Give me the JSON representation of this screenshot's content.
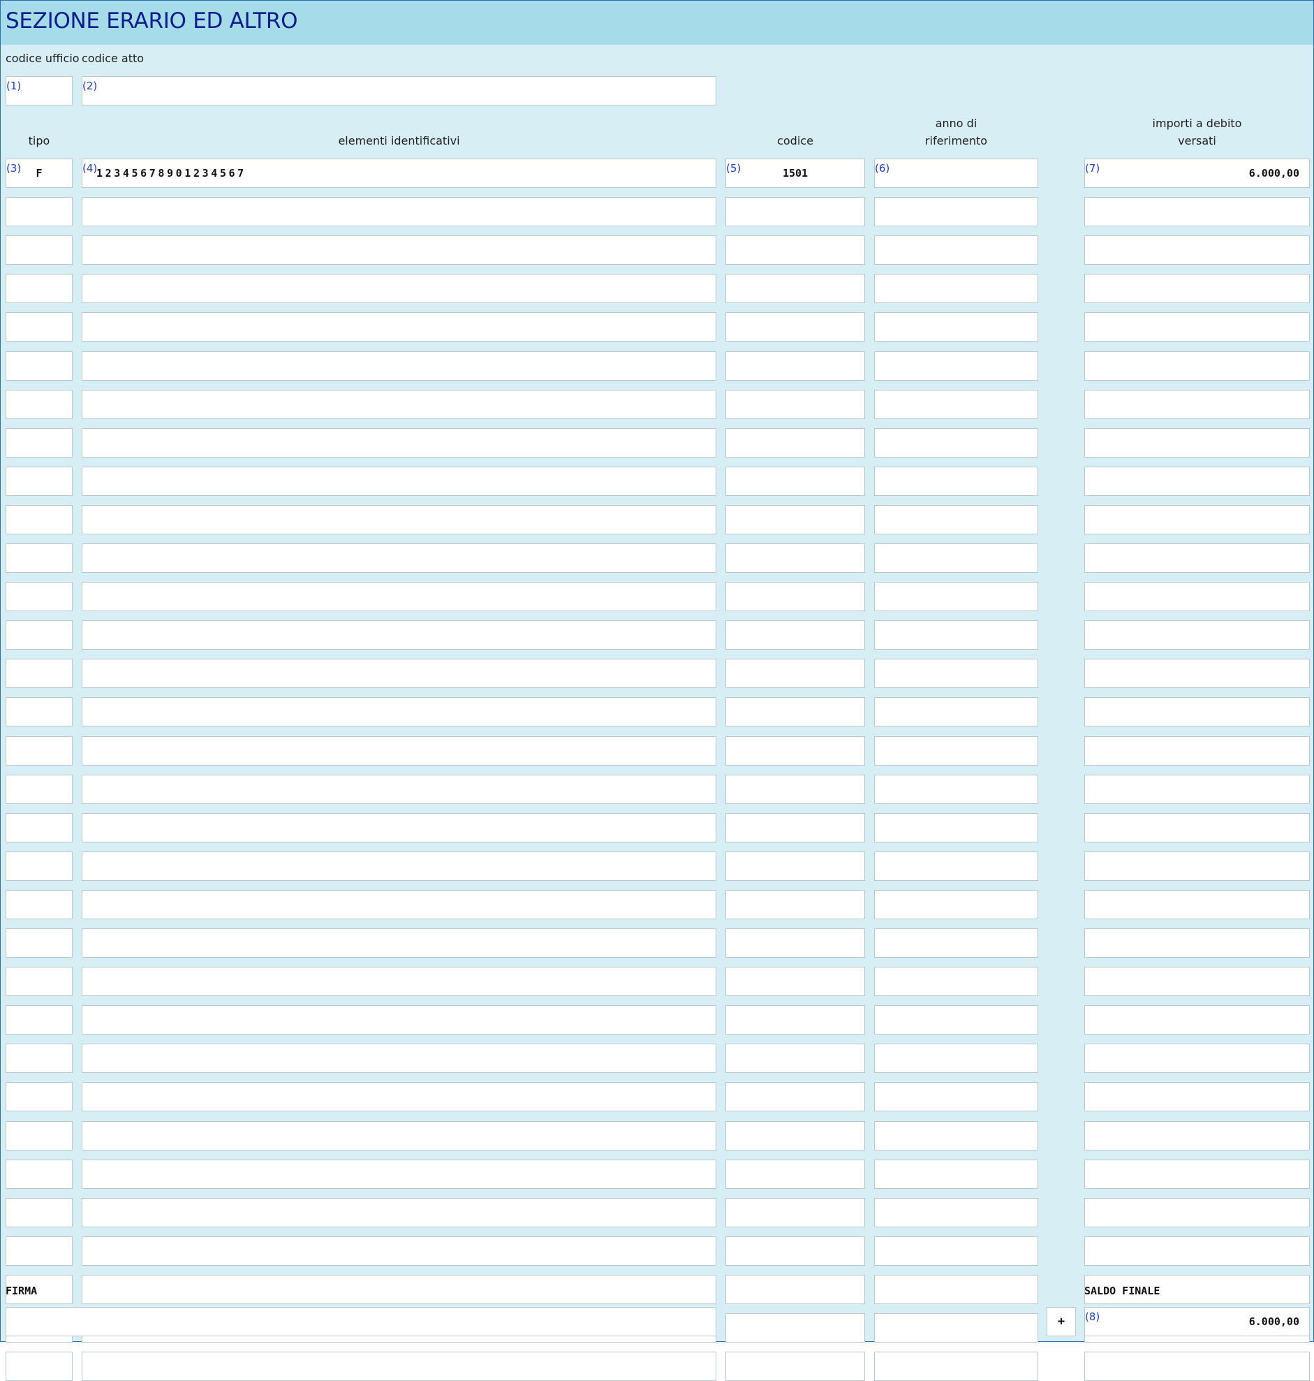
{
  "title": "SEZIONE ERARIO ED ALTRO",
  "labels": {
    "codice_ufficio": "codice ufficio",
    "codice_atto": "codice atto",
    "tipo": "tipo",
    "elementi_identificativi": "elementi identificativi",
    "codice": "codice",
    "anno_line1": "anno di",
    "anno_line2": "riferimento",
    "importi_line1": "importi a debito",
    "importi_line2": "versati",
    "firma": "FIRMA",
    "saldo_finale": "SALDO FINALE"
  },
  "field_numbers": {
    "codice_ufficio": "(1)",
    "codice_atto": "(2)",
    "tipo": "(3)",
    "elementi": "(4)",
    "codice": "(5)",
    "anno": "(6)",
    "importi": "(7)",
    "saldo": "(8)"
  },
  "top_fields": {
    "codice_ufficio": "",
    "codice_atto": ""
  },
  "rows": [
    {
      "tipo": "F",
      "elementi": "12345678901234567",
      "codice": "1501",
      "anno": "",
      "importo": "6.000,00"
    },
    {
      "tipo": "",
      "elementi": "",
      "codice": "",
      "anno": "",
      "importo": ""
    },
    {
      "tipo": "",
      "elementi": "",
      "codice": "",
      "anno": "",
      "importo": ""
    },
    {
      "tipo": "",
      "elementi": "",
      "codice": "",
      "anno": "",
      "importo": ""
    },
    {
      "tipo": "",
      "elementi": "",
      "codice": "",
      "anno": "",
      "importo": ""
    },
    {
      "tipo": "",
      "elementi": "",
      "codice": "",
      "anno": "",
      "importo": ""
    },
    {
      "tipo": "",
      "elementi": "",
      "codice": "",
      "anno": "",
      "importo": ""
    },
    {
      "tipo": "",
      "elementi": "",
      "codice": "",
      "anno": "",
      "importo": ""
    },
    {
      "tipo": "",
      "elementi": "",
      "codice": "",
      "anno": "",
      "importo": ""
    },
    {
      "tipo": "",
      "elementi": "",
      "codice": "",
      "anno": "",
      "importo": ""
    },
    {
      "tipo": "",
      "elementi": "",
      "codice": "",
      "anno": "",
      "importo": ""
    },
    {
      "tipo": "",
      "elementi": "",
      "codice": "",
      "anno": "",
      "importo": ""
    },
    {
      "tipo": "",
      "elementi": "",
      "codice": "",
      "anno": "",
      "importo": ""
    },
    {
      "tipo": "",
      "elementi": "",
      "codice": "",
      "anno": "",
      "importo": ""
    },
    {
      "tipo": "",
      "elementi": "",
      "codice": "",
      "anno": "",
      "importo": ""
    },
    {
      "tipo": "",
      "elementi": "",
      "codice": "",
      "anno": "",
      "importo": ""
    },
    {
      "tipo": "",
      "elementi": "",
      "codice": "",
      "anno": "",
      "importo": ""
    },
    {
      "tipo": "",
      "elementi": "",
      "codice": "",
      "anno": "",
      "importo": ""
    },
    {
      "tipo": "",
      "elementi": "",
      "codice": "",
      "anno": "",
      "importo": ""
    },
    {
      "tipo": "",
      "elementi": "",
      "codice": "",
      "anno": "",
      "importo": ""
    },
    {
      "tipo": "",
      "elementi": "",
      "codice": "",
      "anno": "",
      "importo": ""
    },
    {
      "tipo": "",
      "elementi": "",
      "codice": "",
      "anno": "",
      "importo": ""
    },
    {
      "tipo": "",
      "elementi": "",
      "codice": "",
      "anno": "",
      "importo": ""
    },
    {
      "tipo": "",
      "elementi": "",
      "codice": "",
      "anno": "",
      "importo": ""
    },
    {
      "tipo": "",
      "elementi": "",
      "codice": "",
      "anno": "",
      "importo": ""
    },
    {
      "tipo": "",
      "elementi": "",
      "codice": "",
      "anno": "",
      "importo": ""
    },
    {
      "tipo": "",
      "elementi": "",
      "codice": "",
      "anno": "",
      "importo": ""
    },
    {
      "tipo": "",
      "elementi": "",
      "codice": "",
      "anno": "",
      "importo": ""
    },
    {
      "tipo": "",
      "elementi": "",
      "codice": "",
      "anno": "",
      "importo": ""
    },
    {
      "tipo": "",
      "elementi": "",
      "codice": "",
      "anno": "",
      "importo": ""
    },
    {
      "tipo": "",
      "elementi": "",
      "codice": "",
      "anno": "",
      "importo": ""
    },
    {
      "tipo": "",
      "elementi": "",
      "codice": "",
      "anno": "",
      "importo": ""
    }
  ],
  "firma_value": "",
  "saldo": {
    "sign": "+",
    "value": "6.000,00"
  },
  "colors": {
    "background": "#d8eef5",
    "header": "#a6dcea",
    "title": "#0b1f8c",
    "field_number": "#1f3fbf"
  }
}
